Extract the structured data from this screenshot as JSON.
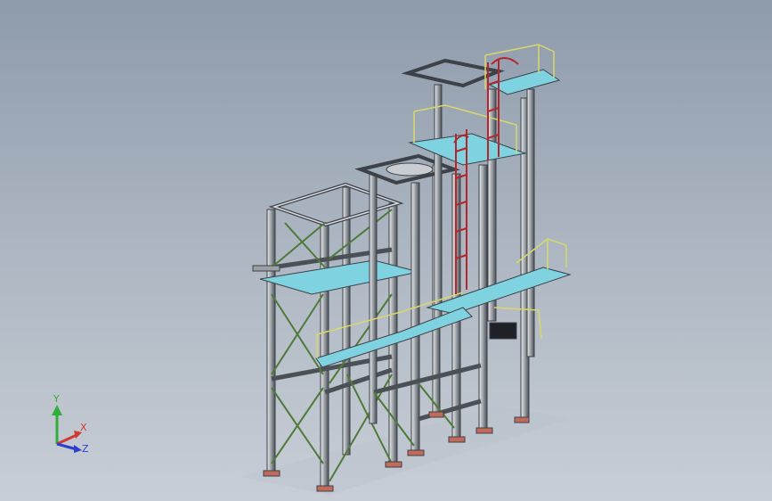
{
  "viewport": {
    "background_top": "#8e9bab",
    "background_bottom": "#c8ced6"
  },
  "model": {
    "description_icon": "steel-structure-model",
    "colors": {
      "steel": "#5a5f66",
      "steel_light": "#c9cdd2",
      "bracing": "#4f7a3a",
      "platform": "#7fd3e0",
      "handrail": "#d8d86a",
      "ladder": "#b3262b"
    }
  },
  "triad": {
    "y_label": "Y",
    "x_label": "X",
    "z_label": "Z",
    "y_color": "#2fae3a",
    "x_color": "#d23a2e",
    "z_color": "#2b3fd1"
  }
}
